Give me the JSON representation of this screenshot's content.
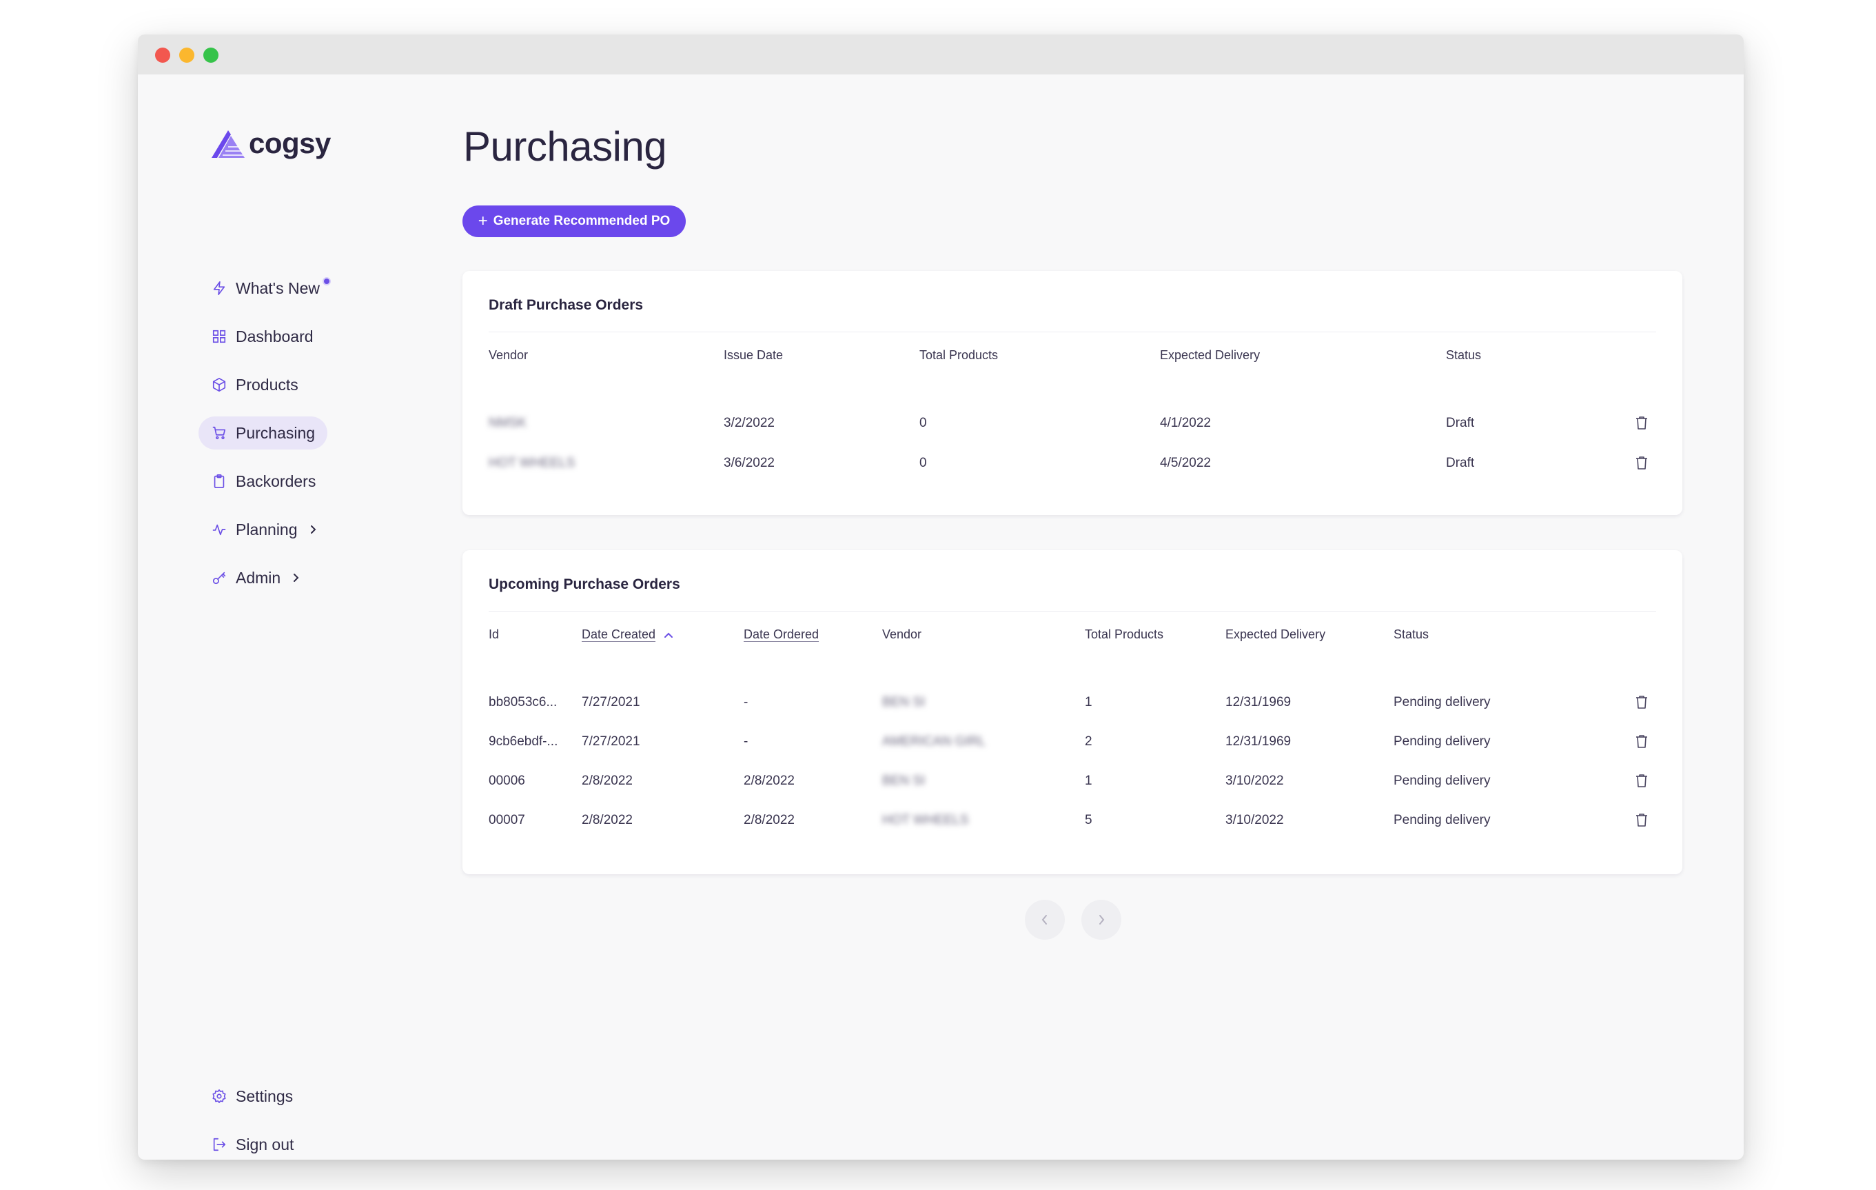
{
  "brand": {
    "name": "cogsy"
  },
  "sidebar": {
    "items": [
      {
        "label": "What's New",
        "icon": "bolt-icon",
        "badge": true
      },
      {
        "label": "Dashboard",
        "icon": "grid-icon"
      },
      {
        "label": "Products",
        "icon": "cube-icon"
      },
      {
        "label": "Purchasing",
        "icon": "cart-icon",
        "active": true
      },
      {
        "label": "Backorders",
        "icon": "clipboard-icon"
      },
      {
        "label": "Planning",
        "icon": "activity-icon",
        "expandable": true
      },
      {
        "label": "Admin",
        "icon": "key-icon",
        "expandable": true
      }
    ],
    "footer": [
      {
        "label": "Settings",
        "icon": "gear-icon"
      },
      {
        "label": "Sign out",
        "icon": "signout-icon"
      }
    ]
  },
  "main": {
    "title": "Purchasing",
    "generate_button": "Generate Recommended PO",
    "draft": {
      "title": "Draft Purchase Orders",
      "columns": [
        "Vendor",
        "Issue Date",
        "Total Products",
        "Expected Delivery",
        "Status"
      ],
      "rows": [
        {
          "vendor": "NMSK",
          "issue_date": "3/2/2022",
          "total_products": "0",
          "expected_delivery": "4/1/2022",
          "status": "Draft"
        },
        {
          "vendor": "HOT WHEELS",
          "issue_date": "3/6/2022",
          "total_products": "0",
          "expected_delivery": "4/5/2022",
          "status": "Draft"
        }
      ]
    },
    "upcoming": {
      "title": "Upcoming Purchase Orders",
      "columns": [
        "Id",
        "Date Created",
        "Date Ordered",
        "Vendor",
        "Total Products",
        "Expected Delivery",
        "Status"
      ],
      "rows": [
        {
          "id": "bb8053c6...",
          "date_created": "7/27/2021",
          "date_ordered": "-",
          "vendor": "BEN SI",
          "total_products": "1",
          "expected_delivery": "12/31/1969",
          "status": "Pending delivery"
        },
        {
          "id": "9cb6ebdf-...",
          "date_created": "7/27/2021",
          "date_ordered": "-",
          "vendor": "AMERICAN GIRL",
          "total_products": "2",
          "expected_delivery": "12/31/1969",
          "status": "Pending delivery"
        },
        {
          "id": "00006",
          "date_created": "2/8/2022",
          "date_ordered": "2/8/2022",
          "vendor": "BEN SI",
          "total_products": "1",
          "expected_delivery": "3/10/2022",
          "status": "Pending delivery"
        },
        {
          "id": "00007",
          "date_created": "2/8/2022",
          "date_ordered": "2/8/2022",
          "vendor": "HOT WHEELS",
          "total_products": "5",
          "expected_delivery": "3/10/2022",
          "status": "Pending delivery"
        }
      ]
    }
  },
  "colors": {
    "accent": "#6b48ec",
    "active_bg": "#e9e5f8"
  }
}
